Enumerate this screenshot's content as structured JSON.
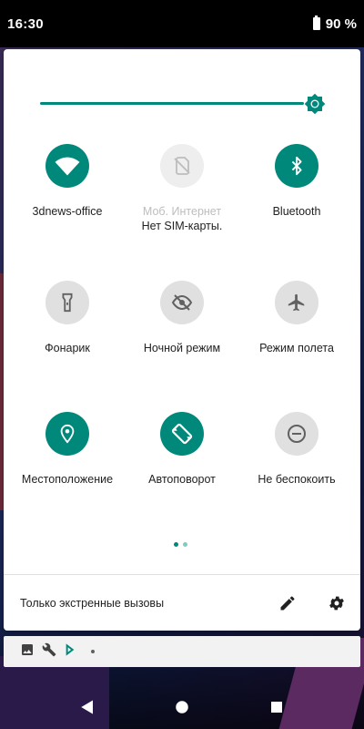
{
  "status_bar": {
    "time": "16:30",
    "battery_percent": "90 %"
  },
  "brightness": {
    "level": 0.93
  },
  "tiles": [
    {
      "label": "3dnews-office",
      "icon": "wifi-icon",
      "state": "on"
    },
    {
      "label": "Моб. Интернет",
      "sublabel": "Нет SIM-карты.",
      "icon": "no-sim-icon",
      "state": "disabled"
    },
    {
      "label": "Bluetooth",
      "icon": "bluetooth-icon",
      "state": "on"
    },
    {
      "label": "Фонарик",
      "icon": "flashlight-icon",
      "state": "off"
    },
    {
      "label": "Ночной режим",
      "icon": "night-mode-icon",
      "state": "off"
    },
    {
      "label": "Режим полета",
      "icon": "airplane-icon",
      "state": "off"
    },
    {
      "label": "Местоположение",
      "icon": "location-icon",
      "state": "on"
    },
    {
      "label": "Автоповорот",
      "icon": "autorotate-icon",
      "state": "on"
    },
    {
      "label": "Не беспокоить",
      "icon": "do-not-disturb-icon",
      "state": "off"
    }
  ],
  "pager": {
    "pages": 2,
    "current": 1
  },
  "footer": {
    "text": "Только экстренные вызовы",
    "edit_icon": "pencil-icon",
    "settings_icon": "gear-icon"
  },
  "notifications": {
    "icons": [
      "image-icon",
      "wrench-icon",
      "play-store-icon"
    ]
  },
  "navigation": {
    "buttons": [
      "back-icon",
      "home-icon",
      "recents-icon"
    ]
  },
  "colors": {
    "accent": "#00897b",
    "tile_off": "#e0e0e0",
    "tile_disabled": "#eeeeee",
    "text": "#212121"
  }
}
